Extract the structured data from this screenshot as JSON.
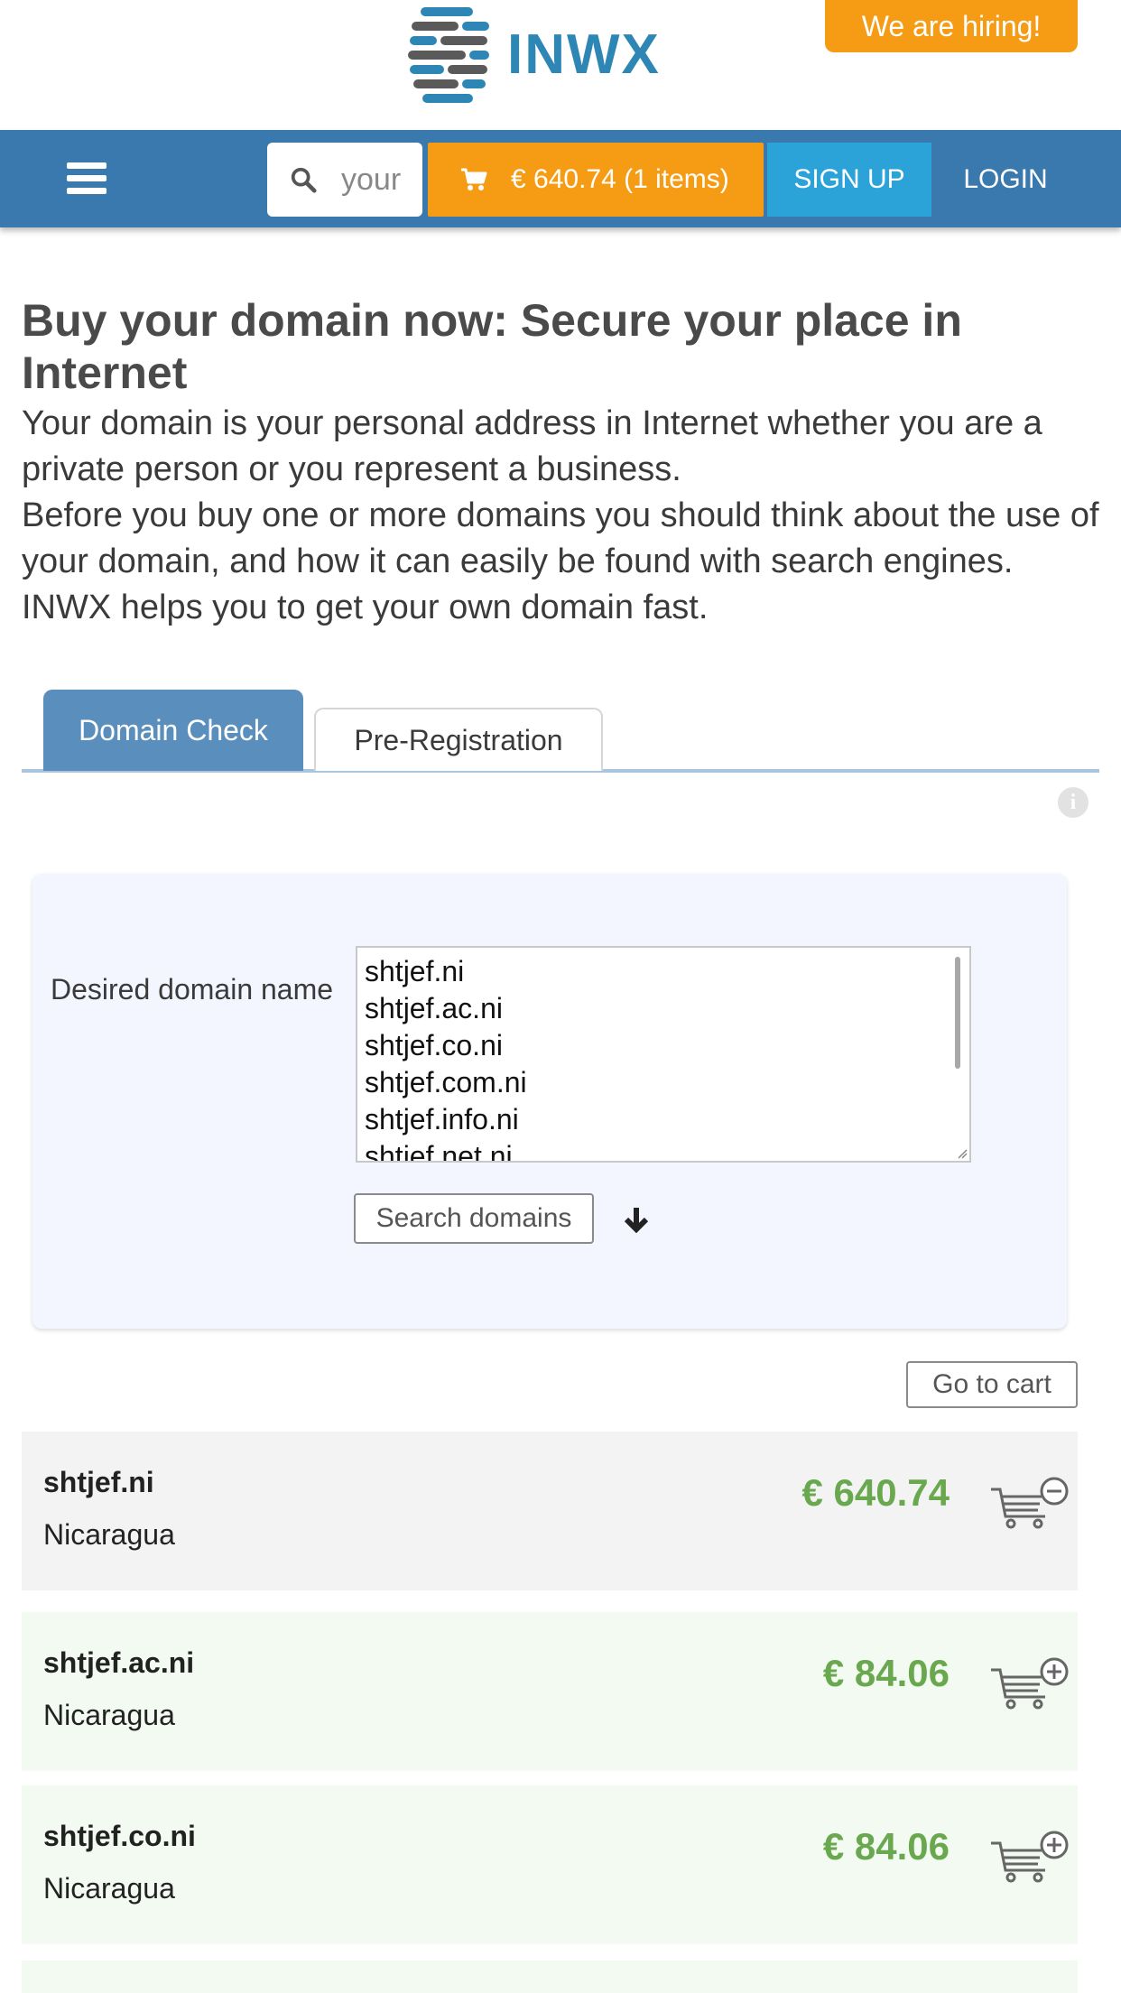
{
  "header": {
    "logo_text": "INWX",
    "hiring_label": "We are hiring!"
  },
  "nav": {
    "search_placeholder": "your",
    "cart_label": "€ 640.74 (1 items)",
    "signup_label": "SIGN UP",
    "login_label": "LOGIN"
  },
  "page": {
    "title": "Buy your domain now: Secure your place in Internet",
    "intro": [
      "Your domain is your personal address in Internet whether you are a private person or you represent a business.",
      "Before you buy one or more domains you should think about the use of your domain, and how it can easily be found with search engines.",
      "INWX helps you to get your own domain fast."
    ]
  },
  "tabs": {
    "active": "Domain Check",
    "other": "Pre-Registration"
  },
  "check": {
    "field_label": "Desired domain name",
    "textarea_lines": [
      "shtjef.ni",
      "shtjef.ac.ni",
      "shtjef.co.ni",
      "shtjef.com.ni",
      "shtjef.info.ni",
      "shtjef.net.ni"
    ],
    "search_button": "Search domains"
  },
  "go_to_cart": "Go to cart",
  "results": [
    {
      "domain": "shtjef.ni",
      "country": "Nicaragua",
      "price": "€ 640.74",
      "in_cart": true,
      "action_icon": "cart-remove-icon"
    },
    {
      "domain": "shtjef.ac.ni",
      "country": "Nicaragua",
      "price": "€ 84.06",
      "in_cart": false,
      "action_icon": "cart-add-icon"
    },
    {
      "domain": "shtjef.co.ni",
      "country": "Nicaragua",
      "price": "€ 84.06",
      "in_cart": false,
      "action_icon": "cart-add-icon"
    }
  ],
  "colors": {
    "nav_bg": "#3a79ad",
    "accent_orange": "#f59b14",
    "signup_blue": "#2ba3d9",
    "tab_active": "#5a8fbd",
    "price_green": "#6aa84f"
  }
}
